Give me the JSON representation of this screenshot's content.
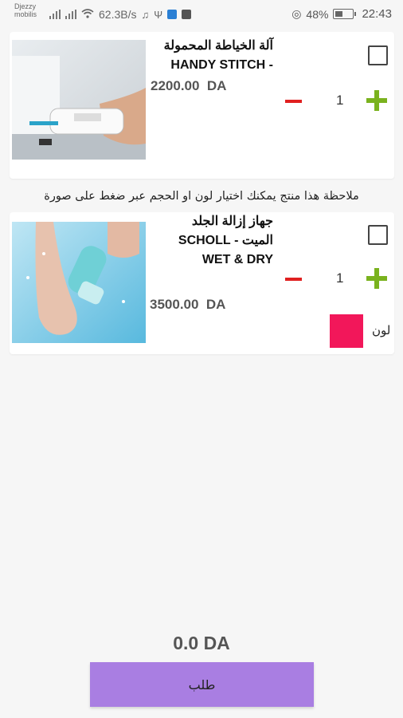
{
  "status_bar": {
    "carrier": "Djezzy mobilis",
    "speed": "62.3B/s",
    "battery": "48%",
    "time": "22:43"
  },
  "products": [
    {
      "title_ar": "آلة الخياطة المحمولة",
      "title_en": "HANDY STITCH -",
      "price": "2200.00  DA",
      "quantity": "1"
    },
    {
      "title_ar": "جهاز إزالة الجلد",
      "title_ar2": "الميت -  SCHOLL",
      "title_en": "WET & DRY",
      "price": "3500.00  DA",
      "quantity": "1",
      "color_label": "لون",
      "color": "#f2175a"
    }
  ],
  "note": "ملاحظة هذا منتج يمكنك اختيار لون او الحجم عبر ضغط على صورة",
  "total": "0.0 DA",
  "order_button": "طلب",
  "colors": {
    "minus": "#e02020",
    "plus": "#7ab21e",
    "order_button": "#a97ee2"
  }
}
